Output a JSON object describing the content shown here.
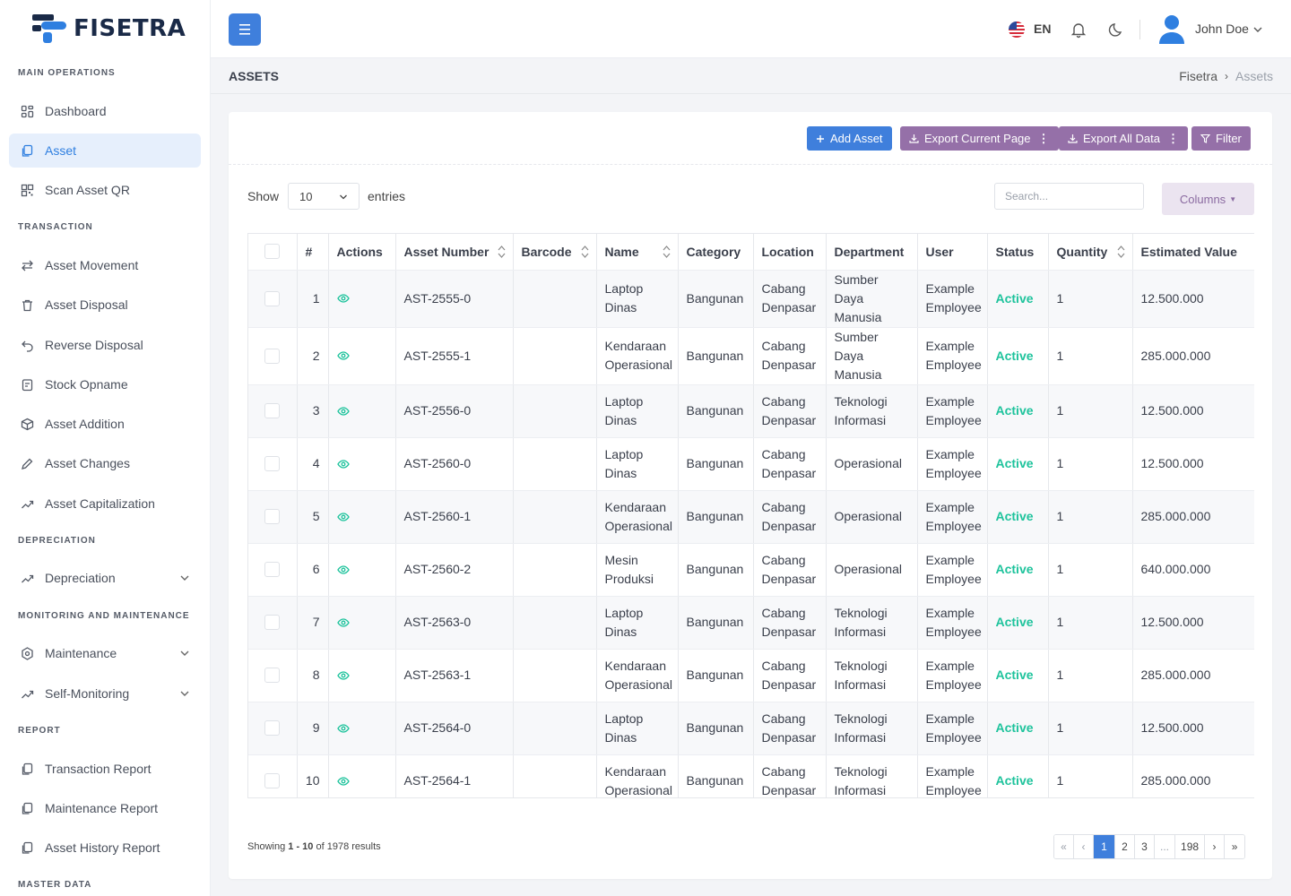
{
  "brand": {
    "name": "FISETRA"
  },
  "sidebar": {
    "sections": [
      {
        "title": "MAIN OPERATIONS",
        "items": [
          {
            "label": "Dashboard",
            "icon": "grid-icon"
          },
          {
            "label": "Asset",
            "icon": "copy-icon",
            "active": true
          },
          {
            "label": "Scan Asset QR",
            "icon": "qr-icon"
          }
        ]
      },
      {
        "title": "TRANSACTION",
        "items": [
          {
            "label": "Asset Movement",
            "icon": "arrows-icon"
          },
          {
            "label": "Asset Disposal",
            "icon": "trash-icon"
          },
          {
            "label": "Reverse Disposal",
            "icon": "undo-icon"
          },
          {
            "label": "Stock Opname",
            "icon": "clipboard-icon"
          },
          {
            "label": "Asset Addition",
            "icon": "box-icon"
          },
          {
            "label": "Asset Changes",
            "icon": "pencil-icon"
          },
          {
            "label": "Asset Capitalization",
            "icon": "trend-icon"
          }
        ]
      },
      {
        "title": "DEPRECIATION",
        "items": [
          {
            "label": "Depreciation",
            "icon": "trend-icon",
            "expandable": true
          }
        ]
      },
      {
        "title": "MONITORING AND MAINTENANCE",
        "items": [
          {
            "label": "Maintenance",
            "icon": "hexagon-icon",
            "expandable": true
          },
          {
            "label": "Self-Monitoring",
            "icon": "trend-icon",
            "expandable": true
          }
        ]
      },
      {
        "title": "REPORT",
        "items": [
          {
            "label": "Transaction Report",
            "icon": "copy-icon"
          },
          {
            "label": "Maintenance Report",
            "icon": "copy-icon"
          },
          {
            "label": "Asset History Report",
            "icon": "copy-icon"
          }
        ]
      },
      {
        "title": "MASTER DATA",
        "items": []
      }
    ]
  },
  "topbar": {
    "lang": "EN",
    "user": "John Doe"
  },
  "page": {
    "title": "ASSETS",
    "breadcrumb": [
      "Fisetra",
      "Assets"
    ]
  },
  "toolbar": {
    "add": "Add Asset",
    "export_page": "Export Current Page",
    "export_all": "Export All Data",
    "filter": "Filter"
  },
  "controls": {
    "show": "Show",
    "page_size": "10",
    "entries": "entries",
    "search_placeholder": "Search...",
    "columns": "Columns"
  },
  "table": {
    "headers": [
      "#",
      "Actions",
      "Asset Number",
      "Barcode",
      "Name",
      "Category",
      "Location",
      "Department",
      "User",
      "Status",
      "Quantity",
      "Estimated Value"
    ],
    "rows": [
      {
        "no": "1",
        "asset_number": "AST-2555-0",
        "barcode": "",
        "name": "Laptop Dinas",
        "category": "Bangunan",
        "location": "Cabang Denpasar",
        "department": "Sumber Daya Manusia",
        "user": "Example Employee",
        "status": "Active",
        "quantity": "1",
        "value": "12.500.000"
      },
      {
        "no": "2",
        "asset_number": "AST-2555-1",
        "barcode": "",
        "name": "Kendaraan Operasional",
        "category": "Bangunan",
        "location": "Cabang Denpasar",
        "department": "Sumber Daya Manusia",
        "user": "Example Employee",
        "status": "Active",
        "quantity": "1",
        "value": "285.000.000"
      },
      {
        "no": "3",
        "asset_number": "AST-2556-0",
        "barcode": "",
        "name": "Laptop Dinas",
        "category": "Bangunan",
        "location": "Cabang Denpasar",
        "department": "Teknologi Informasi",
        "user": "Example Employee",
        "status": "Active",
        "quantity": "1",
        "value": "12.500.000"
      },
      {
        "no": "4",
        "asset_number": "AST-2560-0",
        "barcode": "",
        "name": "Laptop Dinas",
        "category": "Bangunan",
        "location": "Cabang Denpasar",
        "department": "Operasional",
        "user": "Example Employee",
        "status": "Active",
        "quantity": "1",
        "value": "12.500.000"
      },
      {
        "no": "5",
        "asset_number": "AST-2560-1",
        "barcode": "",
        "name": "Kendaraan Operasional",
        "category": "Bangunan",
        "location": "Cabang Denpasar",
        "department": "Operasional",
        "user": "Example Employee",
        "status": "Active",
        "quantity": "1",
        "value": "285.000.000"
      },
      {
        "no": "6",
        "asset_number": "AST-2560-2",
        "barcode": "",
        "name": "Mesin Produksi",
        "category": "Bangunan",
        "location": "Cabang Denpasar",
        "department": "Operasional",
        "user": "Example Employee",
        "status": "Active",
        "quantity": "1",
        "value": "640.000.000"
      },
      {
        "no": "7",
        "asset_number": "AST-2563-0",
        "barcode": "",
        "name": "Laptop Dinas",
        "category": "Bangunan",
        "location": "Cabang Denpasar",
        "department": "Teknologi Informasi",
        "user": "Example Employee",
        "status": "Active",
        "quantity": "1",
        "value": "12.500.000"
      },
      {
        "no": "8",
        "asset_number": "AST-2563-1",
        "barcode": "",
        "name": "Kendaraan Operasional",
        "category": "Bangunan",
        "location": "Cabang Denpasar",
        "department": "Teknologi Informasi",
        "user": "Example Employee",
        "status": "Active",
        "quantity": "1",
        "value": "285.000.000"
      },
      {
        "no": "9",
        "asset_number": "AST-2564-0",
        "barcode": "",
        "name": "Laptop Dinas",
        "category": "Bangunan",
        "location": "Cabang Denpasar",
        "department": "Teknologi Informasi",
        "user": "Example Employee",
        "status": "Active",
        "quantity": "1",
        "value": "12.500.000"
      },
      {
        "no": "10",
        "asset_number": "AST-2564-1",
        "barcode": "",
        "name": "Kendaraan Operasional",
        "category": "Bangunan",
        "location": "Cabang Denpasar",
        "department": "Teknologi Informasi",
        "user": "Example Employee",
        "status": "Active",
        "quantity": "1",
        "value": "285.000.000"
      }
    ]
  },
  "footer": {
    "showing_prefix": "Showing",
    "range": "1 - 10",
    "of": "of",
    "total": "1978",
    "suffix": "results",
    "pages": [
      "«",
      "‹",
      "1",
      "2",
      "3",
      "...",
      "198",
      "›",
      "»"
    ],
    "current_page": "1"
  },
  "colors": {
    "accent": "#3f7fdc",
    "purple": "#9570a8",
    "status_active": "#1ec39c"
  }
}
